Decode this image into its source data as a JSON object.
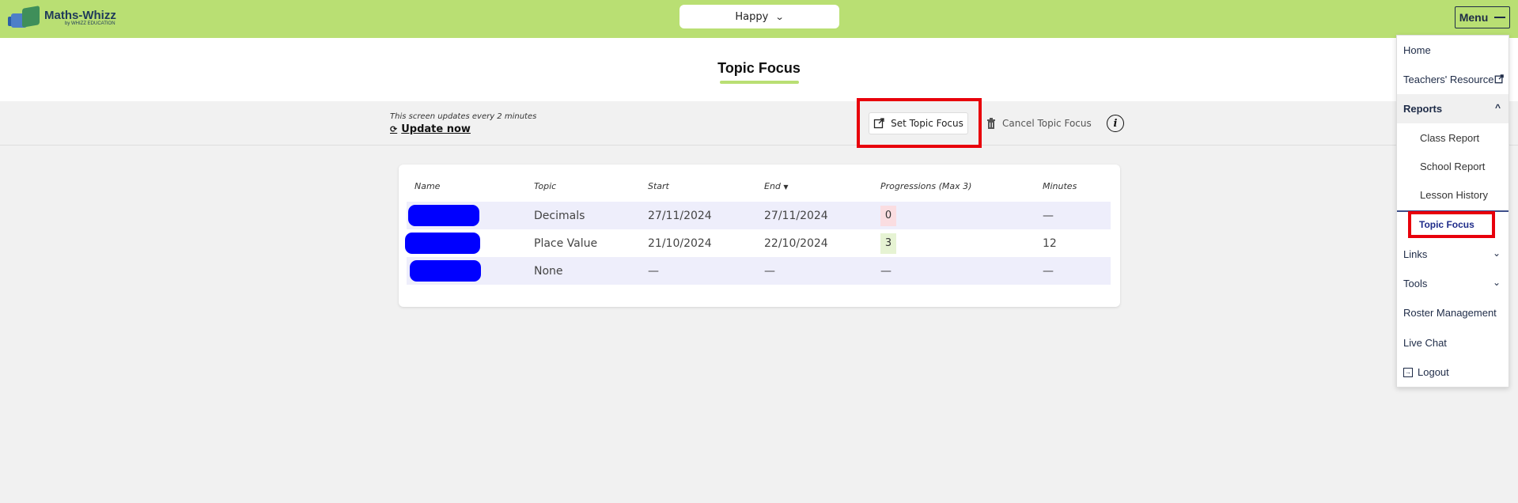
{
  "header": {
    "logo_text": "Maths-Whizz",
    "logo_sub": "by WHIZZ EDUCATION",
    "class_selector": "Happy",
    "menu_label": "Menu"
  },
  "page": {
    "title": "Topic Focus"
  },
  "toolbar": {
    "update_note": "This screen updates every 2 minutes",
    "update_now": "Update now",
    "set_focus": "Set Topic Focus",
    "cancel_focus": "Cancel Topic Focus"
  },
  "table": {
    "headers": {
      "name": "Name",
      "topic": "Topic",
      "start": "Start",
      "end": "End",
      "progressions": "Progressions (Max 3)",
      "minutes": "Minutes"
    },
    "rows": [
      {
        "topic": "Decimals",
        "start": "27/11/2024",
        "end": "27/11/2024",
        "progressions": "0",
        "minutes": "—"
      },
      {
        "topic": "Place Value",
        "start": "21/10/2024",
        "end": "22/10/2024",
        "progressions": "3",
        "minutes": "12"
      },
      {
        "topic": "None",
        "start": "—",
        "end": "—",
        "progressions": "—",
        "minutes": "—"
      }
    ]
  },
  "menu": {
    "home": "Home",
    "teachers_resource": "Teachers' Resource",
    "reports": "Reports",
    "class_report": "Class Report",
    "school_report": "School Report",
    "lesson_history": "Lesson History",
    "topic_focus": "Topic Focus",
    "links": "Links",
    "tools": "Tools",
    "roster": "Roster Management",
    "live_chat": "Live Chat",
    "logout": "Logout"
  },
  "colors": {
    "header_green": "#b9df73",
    "highlight_red": "#e8000b",
    "redacted_blue": "#0000ff",
    "badge_zero": "#fadde1",
    "badge_three": "#e6f3d3"
  }
}
